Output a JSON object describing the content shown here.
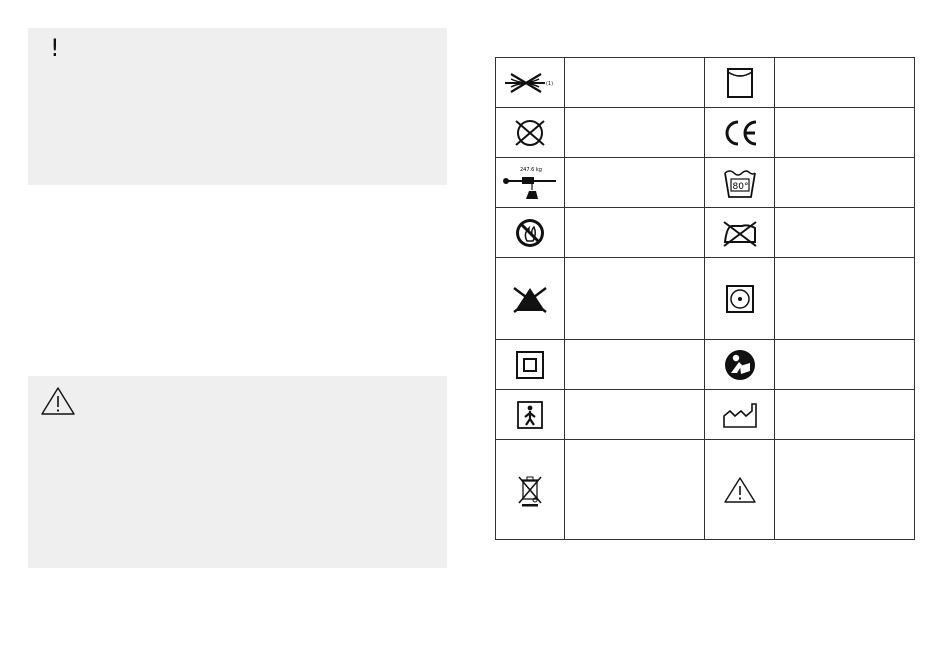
{
  "attention_box": {
    "icon": "exclamation-icon",
    "symbol": "!"
  },
  "warning_box": {
    "icon": "warning-triangle-icon"
  },
  "symbol_table": {
    "rows": [
      {
        "left": {
          "icon": "no-lifting-strap-icon",
          "label": ""
        },
        "right": {
          "icon": "do-not-tumble-dry-icon",
          "label": ""
        }
      },
      {
        "left": {
          "icon": "do-not-dry-clean-icon",
          "label": ""
        },
        "right": {
          "icon": "ce-mark-icon",
          "label": ""
        }
      },
      {
        "left": {
          "icon": "max-load-icon",
          "label": "",
          "load_text": "247.6 kg"
        },
        "right": {
          "icon": "wash-80-icon",
          "label": "",
          "temp_text": "80°"
        }
      },
      {
        "left": {
          "icon": "no-open-flame-icon",
          "label": ""
        },
        "right": {
          "icon": "do-not-iron-icon",
          "label": ""
        }
      },
      {
        "left": {
          "icon": "do-not-bleach-icon",
          "label": ""
        },
        "right": {
          "icon": "tumble-dry-icon",
          "label": ""
        }
      },
      {
        "left": {
          "icon": "double-insulated-icon",
          "label": ""
        },
        "right": {
          "icon": "read-manual-icon",
          "label": ""
        }
      },
      {
        "left": {
          "icon": "type-b-applied-part-icon",
          "label": ""
        },
        "right": {
          "icon": "manufacturer-icon",
          "label": ""
        }
      },
      {
        "left": {
          "icon": "weee-bin-icon",
          "label": ""
        },
        "right": {
          "icon": "caution-triangle-icon",
          "label": ""
        }
      }
    ]
  }
}
